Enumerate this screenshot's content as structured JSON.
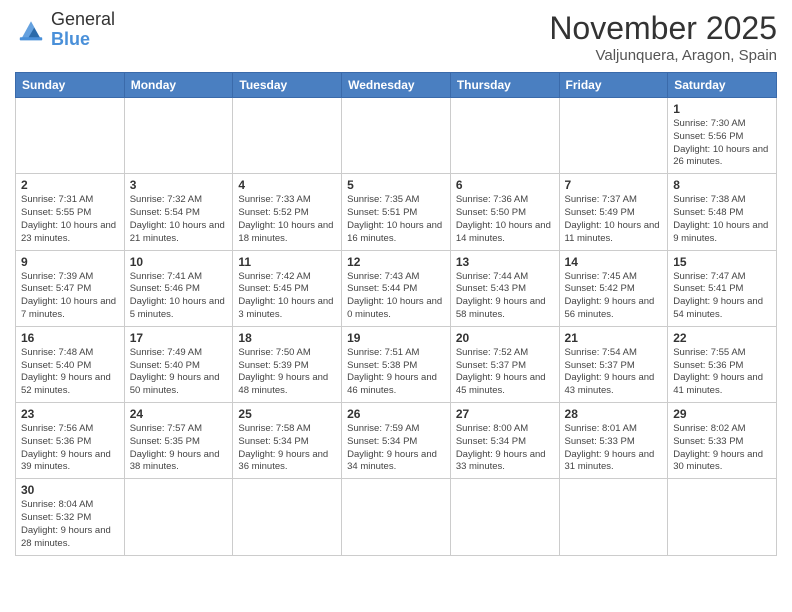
{
  "header": {
    "logo_general": "General",
    "logo_blue": "Blue",
    "month_title": "November 2025",
    "subtitle": "Valjunquera, Aragon, Spain"
  },
  "weekdays": [
    "Sunday",
    "Monday",
    "Tuesday",
    "Wednesday",
    "Thursday",
    "Friday",
    "Saturday"
  ],
  "days": [
    {
      "num": "",
      "info": ""
    },
    {
      "num": "",
      "info": ""
    },
    {
      "num": "",
      "info": ""
    },
    {
      "num": "",
      "info": ""
    },
    {
      "num": "",
      "info": ""
    },
    {
      "num": "",
      "info": ""
    },
    {
      "num": "1",
      "info": "Sunrise: 7:30 AM\nSunset: 5:56 PM\nDaylight: 10 hours\nand 26 minutes."
    },
    {
      "num": "2",
      "info": "Sunrise: 7:31 AM\nSunset: 5:55 PM\nDaylight: 10 hours\nand 23 minutes."
    },
    {
      "num": "3",
      "info": "Sunrise: 7:32 AM\nSunset: 5:54 PM\nDaylight: 10 hours\nand 21 minutes."
    },
    {
      "num": "4",
      "info": "Sunrise: 7:33 AM\nSunset: 5:52 PM\nDaylight: 10 hours\nand 18 minutes."
    },
    {
      "num": "5",
      "info": "Sunrise: 7:35 AM\nSunset: 5:51 PM\nDaylight: 10 hours\nand 16 minutes."
    },
    {
      "num": "6",
      "info": "Sunrise: 7:36 AM\nSunset: 5:50 PM\nDaylight: 10 hours\nand 14 minutes."
    },
    {
      "num": "7",
      "info": "Sunrise: 7:37 AM\nSunset: 5:49 PM\nDaylight: 10 hours\nand 11 minutes."
    },
    {
      "num": "8",
      "info": "Sunrise: 7:38 AM\nSunset: 5:48 PM\nDaylight: 10 hours\nand 9 minutes."
    },
    {
      "num": "9",
      "info": "Sunrise: 7:39 AM\nSunset: 5:47 PM\nDaylight: 10 hours\nand 7 minutes."
    },
    {
      "num": "10",
      "info": "Sunrise: 7:41 AM\nSunset: 5:46 PM\nDaylight: 10 hours\nand 5 minutes."
    },
    {
      "num": "11",
      "info": "Sunrise: 7:42 AM\nSunset: 5:45 PM\nDaylight: 10 hours\nand 3 minutes."
    },
    {
      "num": "12",
      "info": "Sunrise: 7:43 AM\nSunset: 5:44 PM\nDaylight: 10 hours\nand 0 minutes."
    },
    {
      "num": "13",
      "info": "Sunrise: 7:44 AM\nSunset: 5:43 PM\nDaylight: 9 hours\nand 58 minutes."
    },
    {
      "num": "14",
      "info": "Sunrise: 7:45 AM\nSunset: 5:42 PM\nDaylight: 9 hours\nand 56 minutes."
    },
    {
      "num": "15",
      "info": "Sunrise: 7:47 AM\nSunset: 5:41 PM\nDaylight: 9 hours\nand 54 minutes."
    },
    {
      "num": "16",
      "info": "Sunrise: 7:48 AM\nSunset: 5:40 PM\nDaylight: 9 hours\nand 52 minutes."
    },
    {
      "num": "17",
      "info": "Sunrise: 7:49 AM\nSunset: 5:40 PM\nDaylight: 9 hours\nand 50 minutes."
    },
    {
      "num": "18",
      "info": "Sunrise: 7:50 AM\nSunset: 5:39 PM\nDaylight: 9 hours\nand 48 minutes."
    },
    {
      "num": "19",
      "info": "Sunrise: 7:51 AM\nSunset: 5:38 PM\nDaylight: 9 hours\nand 46 minutes."
    },
    {
      "num": "20",
      "info": "Sunrise: 7:52 AM\nSunset: 5:37 PM\nDaylight: 9 hours\nand 45 minutes."
    },
    {
      "num": "21",
      "info": "Sunrise: 7:54 AM\nSunset: 5:37 PM\nDaylight: 9 hours\nand 43 minutes."
    },
    {
      "num": "22",
      "info": "Sunrise: 7:55 AM\nSunset: 5:36 PM\nDaylight: 9 hours\nand 41 minutes."
    },
    {
      "num": "23",
      "info": "Sunrise: 7:56 AM\nSunset: 5:36 PM\nDaylight: 9 hours\nand 39 minutes."
    },
    {
      "num": "24",
      "info": "Sunrise: 7:57 AM\nSunset: 5:35 PM\nDaylight: 9 hours\nand 38 minutes."
    },
    {
      "num": "25",
      "info": "Sunrise: 7:58 AM\nSunset: 5:34 PM\nDaylight: 9 hours\nand 36 minutes."
    },
    {
      "num": "26",
      "info": "Sunrise: 7:59 AM\nSunset: 5:34 PM\nDaylight: 9 hours\nand 34 minutes."
    },
    {
      "num": "27",
      "info": "Sunrise: 8:00 AM\nSunset: 5:34 PM\nDaylight: 9 hours\nand 33 minutes."
    },
    {
      "num": "28",
      "info": "Sunrise: 8:01 AM\nSunset: 5:33 PM\nDaylight: 9 hours\nand 31 minutes."
    },
    {
      "num": "29",
      "info": "Sunrise: 8:02 AM\nSunset: 5:33 PM\nDaylight: 9 hours\nand 30 minutes."
    },
    {
      "num": "30",
      "info": "Sunrise: 8:04 AM\nSunset: 5:32 PM\nDaylight: 9 hours\nand 28 minutes."
    },
    {
      "num": "",
      "info": ""
    },
    {
      "num": "",
      "info": ""
    },
    {
      "num": "",
      "info": ""
    },
    {
      "num": "",
      "info": ""
    },
    {
      "num": "",
      "info": ""
    },
    {
      "num": "",
      "info": ""
    }
  ]
}
